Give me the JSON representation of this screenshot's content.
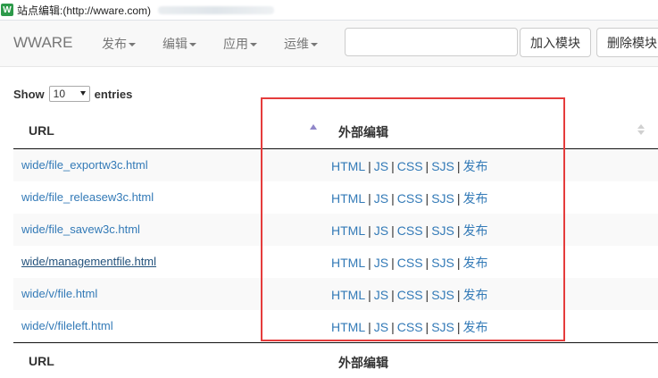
{
  "window": {
    "title": "站点编辑:(http://wware.com)"
  },
  "navbar": {
    "brand": "WWARE",
    "menus": [
      "发布",
      "编辑",
      "应用",
      "运维"
    ],
    "search_value": "",
    "add_button": "加入模块",
    "delete_button": "删除模块"
  },
  "length": {
    "show": "Show",
    "value": "10",
    "entries": "entries"
  },
  "table": {
    "headers": [
      "URL",
      "外部编辑"
    ],
    "rows": [
      {
        "url": "wide/file_exportw3c.html"
      },
      {
        "url": "wide/file_releasew3c.html"
      },
      {
        "url": "wide/file_savew3c.html"
      },
      {
        "url": "wide/managementfile.html"
      },
      {
        "url": "wide/v/file.html"
      },
      {
        "url": "wide/v/fileleft.html"
      }
    ],
    "actions": [
      "HTML",
      "JS",
      "CSS",
      "SJS",
      "发布"
    ],
    "footer": [
      "URL",
      "外部编辑"
    ]
  },
  "colors": {
    "link": "#337ab7",
    "highlight": "#e53c3c",
    "sort_active": "#9087c9"
  }
}
